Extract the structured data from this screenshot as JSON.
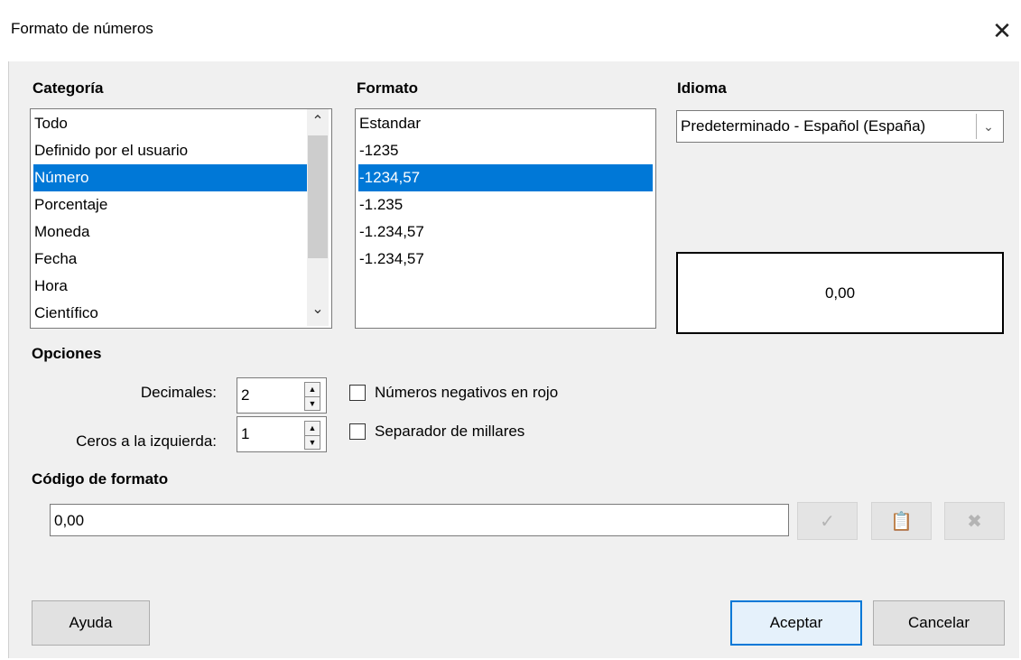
{
  "window": {
    "title": "Formato de números"
  },
  "categoria": {
    "label": "Categoría",
    "items": [
      "Todo",
      "Definido por el usuario",
      "Número",
      "Porcentaje",
      "Moneda",
      "Fecha",
      "Hora",
      "Científico"
    ],
    "selected": "Número"
  },
  "formato": {
    "label": "Formato",
    "items": [
      "Estandar",
      "-1235",
      "-1234,57",
      "-1.235",
      "-1.234,57",
      "-1.234,57"
    ],
    "selected": "-1234,57"
  },
  "idioma": {
    "label": "Idioma",
    "value": "Predeterminado - Español (España)"
  },
  "preview": {
    "value": "0,00"
  },
  "opciones": {
    "label": "Opciones",
    "decimales_label": "Decimales:",
    "decimales_value": "2",
    "ceros_label": "Ceros a la izquierda:",
    "ceros_value": "1",
    "negativos_label": "Números negativos en rojo",
    "negativos_checked": false,
    "separador_label": "Separador de millares",
    "separador_checked": false
  },
  "codigo": {
    "label": "Código de formato",
    "value": "0,00"
  },
  "buttons": {
    "ayuda": "Ayuda",
    "aceptar": "Aceptar",
    "cancelar": "Cancelar"
  },
  "colors": {
    "selection": "#0078d7",
    "accent_border": "#0078d7"
  }
}
